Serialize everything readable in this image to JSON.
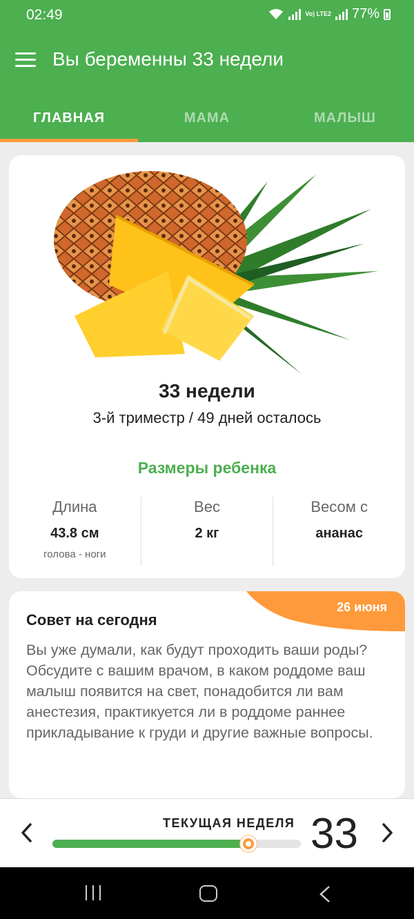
{
  "status": {
    "time": "02:49",
    "battery": "77%",
    "lte": "Vo) LTE2"
  },
  "appbar": {
    "title": "Вы беременны 33 недели",
    "menu_icon": "hamburger-menu-icon"
  },
  "tabs": [
    {
      "label": "ГЛАВНАЯ",
      "active": true
    },
    {
      "label": "МАМА",
      "active": false
    },
    {
      "label": "МАЛЫШ",
      "active": false
    }
  ],
  "week_card": {
    "image": "pineapple-illustration",
    "weeks": "33 недели",
    "subtitle": "3-й триместр / 49 дней осталось",
    "sizes_title": "Размеры ребенка",
    "columns": [
      {
        "label": "Длина",
        "value": "43.8 см",
        "hint": "голова - ноги"
      },
      {
        "label": "Вес",
        "value": "2 кг",
        "hint": ""
      },
      {
        "label": "Весом с",
        "value": "ананас",
        "hint": ""
      }
    ]
  },
  "tip_card": {
    "date": "26 июня",
    "title": "Совет на сегодня",
    "text": "Вы уже думали, как будут проходить ваши роды? Обсудите с вашим врачом, в каком роддоме ваш малыш появится на свет, понадобится ли вам анестезия, практикуется ли в роддоме раннее прикладывание к груди и другие важные вопросы."
  },
  "week_nav": {
    "label": "ТЕКУЩАЯ НЕДЕЛЯ",
    "week": "33",
    "progress": 0.79
  },
  "colors": {
    "green": "#4caf50",
    "orange": "#ff9a3c"
  }
}
